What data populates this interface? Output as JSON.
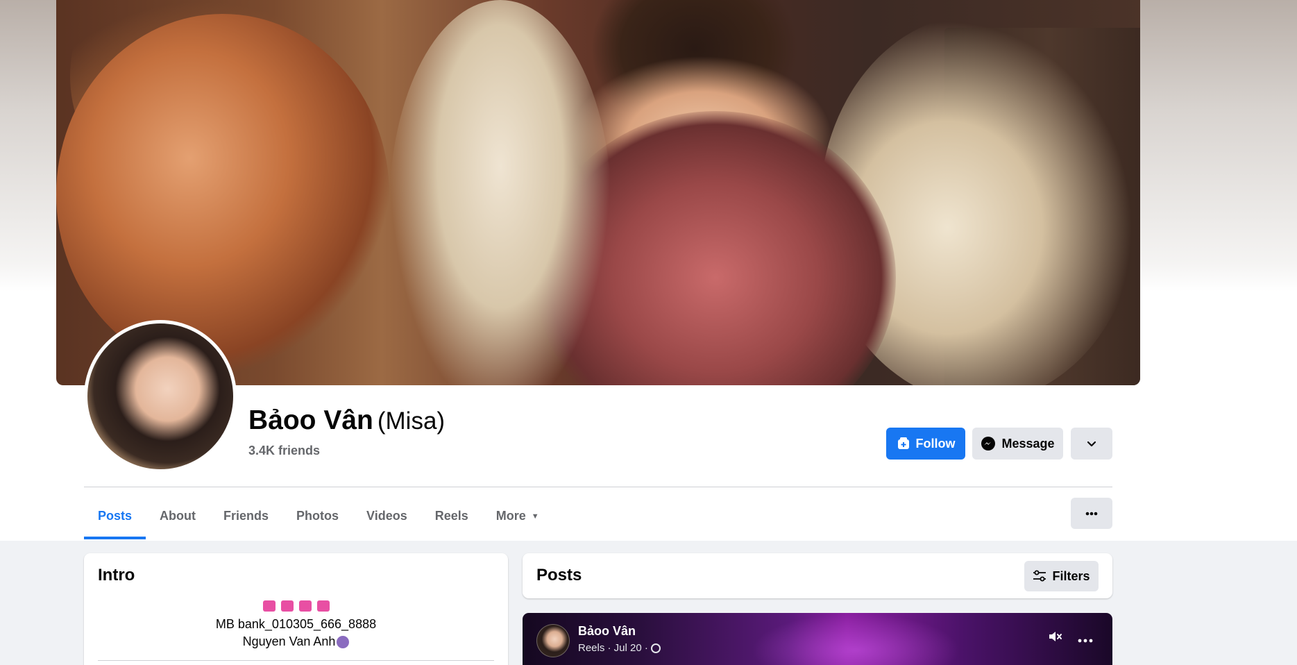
{
  "profile": {
    "name": "Bảoo Vân",
    "nickname": "(Misa)",
    "friends": "3.4K friends"
  },
  "actions": {
    "follow": "Follow",
    "message": "Message"
  },
  "tabs": [
    {
      "label": "Posts"
    },
    {
      "label": "About"
    },
    {
      "label": "Friends"
    },
    {
      "label": "Photos"
    },
    {
      "label": "Videos"
    },
    {
      "label": "Reels"
    },
    {
      "label": "More"
    }
  ],
  "intro": {
    "title": "Intro",
    "line1": "MB bank_010305_666_8888",
    "line2": "Nguyen Van Anh"
  },
  "posts": {
    "title": "Posts",
    "filters": "Filters"
  },
  "reel": {
    "author": "Bảoo Vân",
    "meta": "Reels · Jul 20 ·"
  },
  "colors": {
    "accent": "#1877f2",
    "button_gray": "#e4e6eb",
    "page_bg": "#f0f2f5"
  }
}
